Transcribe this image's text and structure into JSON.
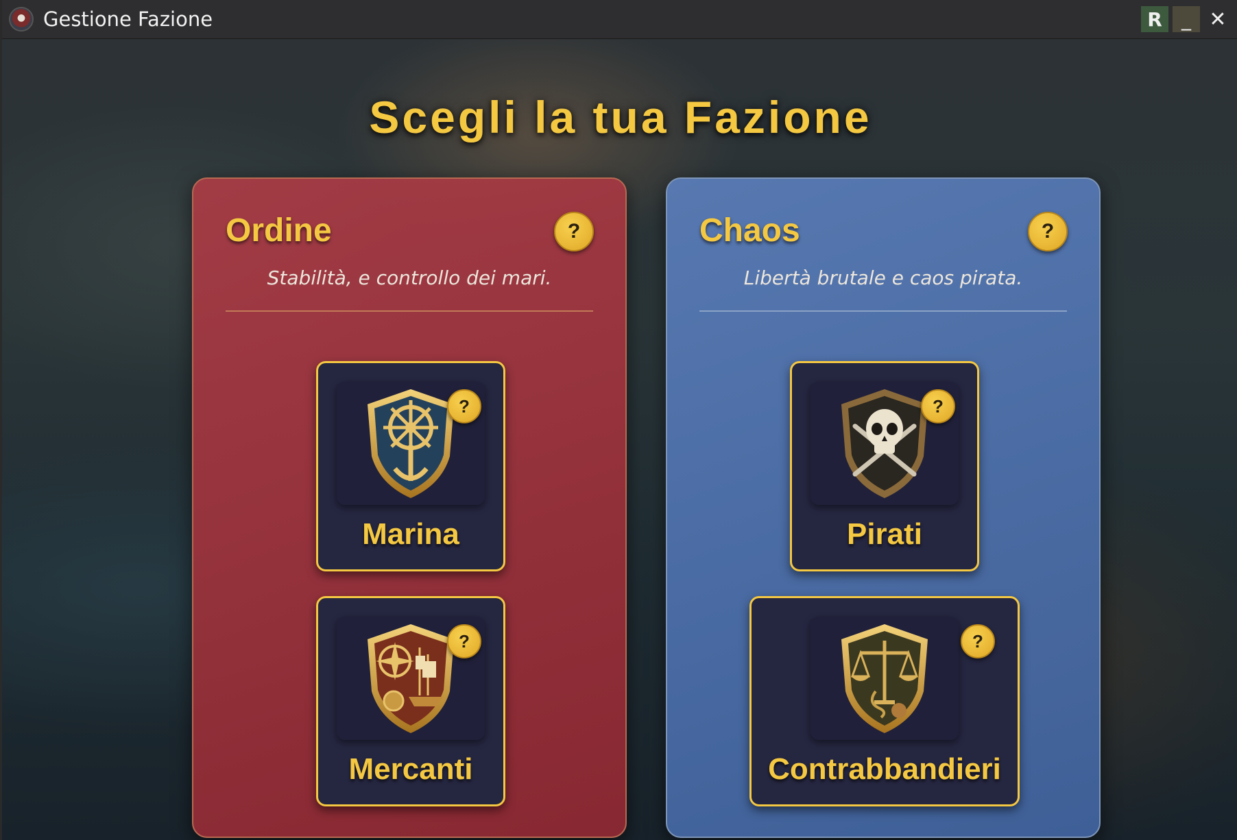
{
  "window": {
    "title": "Gestione Fazione",
    "controls": {
      "r_label": "R",
      "minimize_label": "_",
      "close_label": "✕"
    }
  },
  "heading": "Scegli la tua Fazione",
  "help_label": "?",
  "factions": [
    {
      "title": "Ordine",
      "subtitle": "Stabilità, e controllo dei mari.",
      "color": "#a83c46",
      "subfactions": [
        {
          "name": "Marina",
          "icon": "anchor-wheel-shield-icon"
        },
        {
          "name": "Mercanti",
          "icon": "compass-ship-shield-icon"
        }
      ]
    },
    {
      "title": "Chaos",
      "subtitle": "Libertà brutale e caos pirata.",
      "color": "#5a7db9",
      "subfactions": [
        {
          "name": "Pirati",
          "icon": "skull-swords-shield-icon"
        },
        {
          "name": "Contrabbandieri",
          "icon": "scales-shield-icon"
        }
      ]
    }
  ],
  "accent_color": "#f5c842"
}
